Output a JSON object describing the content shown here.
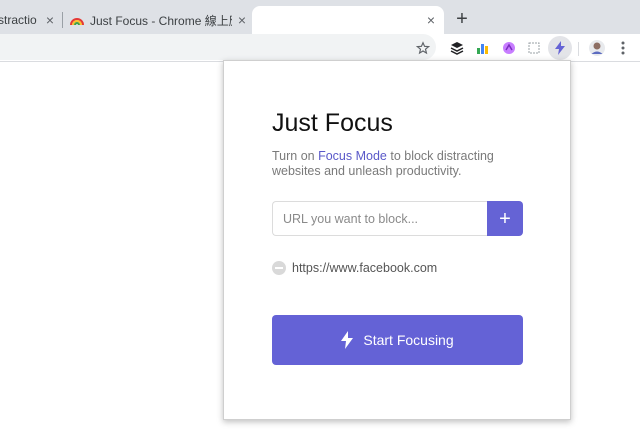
{
  "browser": {
    "tabs": [
      {
        "title": "stractio",
        "active": false
      },
      {
        "title": "Just Focus - Chrome 線上應用",
        "active": false
      },
      {
        "title": "",
        "active": true
      }
    ],
    "toolbar_icons": [
      "star-icon",
      "layers-extension-icon",
      "chart-extension-icon",
      "purple-extension-icon",
      "crop-extension-icon",
      "lightning-extension-icon",
      "profile-avatar",
      "kebab-menu-icon"
    ]
  },
  "popup": {
    "title": "Just Focus",
    "description_prefix": "Turn on ",
    "description_link": "Focus Mode",
    "description_suffix": " to block distracting websites and unleash productivity.",
    "url_input": {
      "placeholder": "URL you want to block...",
      "value": ""
    },
    "add_button_label": "+",
    "blocked_sites": [
      "https://www.facebook.com"
    ],
    "start_button_label": "Start Focusing",
    "accent_color": "#6563d5"
  }
}
